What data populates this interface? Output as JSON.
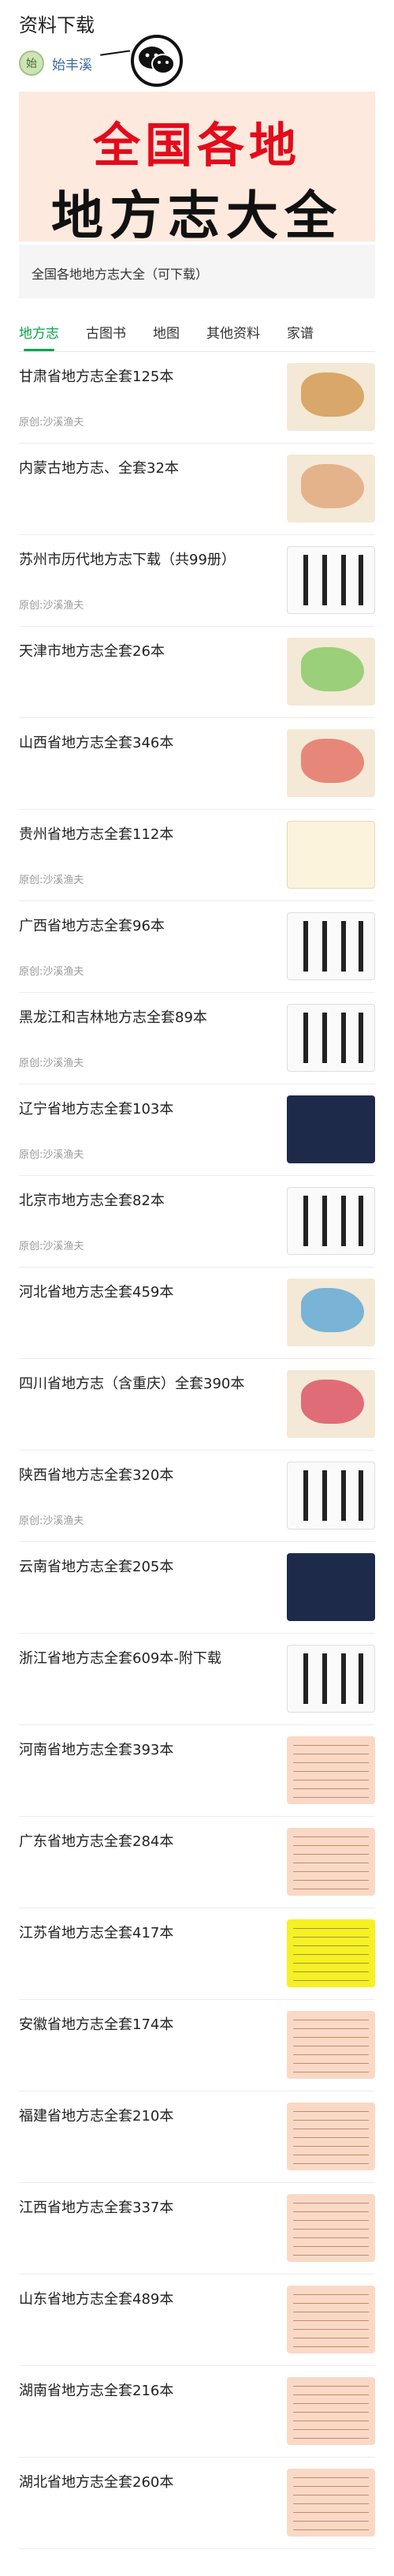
{
  "header": {
    "title": "资料下载",
    "author_name": "始丰溪",
    "avatar_text": "始"
  },
  "banner": {
    "line1": "全国各地",
    "line2": "地方志大全",
    "caption": "全国各地地方志大全（可下载）"
  },
  "tabs": [
    {
      "label": "地方志",
      "active": true
    },
    {
      "label": "古图书",
      "active": false
    },
    {
      "label": "地图",
      "active": false
    },
    {
      "label": "其他资料",
      "active": false
    },
    {
      "label": "家谱",
      "active": false
    }
  ],
  "items": [
    {
      "title": "甘肃省地方志全套125本",
      "source": "原创:沙溪渔夫",
      "thumb": "map",
      "color": "#d9a76a"
    },
    {
      "title": "内蒙古地方志、全套32本",
      "source": "",
      "thumb": "map",
      "color": "#e4b38c"
    },
    {
      "title": "苏州市历代地方志下载（共99册）",
      "source": "原创:沙溪渔夫",
      "thumb": "book",
      "color": "#222222"
    },
    {
      "title": "天津市地方志全套26本",
      "source": "",
      "thumb": "map",
      "color": "#9ccf7a"
    },
    {
      "title": "山西省地方志全套346本",
      "source": "",
      "thumb": "map",
      "color": "#e7877a"
    },
    {
      "title": "贵州省地方志全套112本",
      "source": "原创:沙溪渔夫",
      "thumb": "plain",
      "color": "#e7d9b0"
    },
    {
      "title": "广西省地方志全套96本",
      "source": "原创:沙溪渔夫",
      "thumb": "book",
      "color": "#222222"
    },
    {
      "title": "黑龙江和吉林地方志全套89本",
      "source": "原创:沙溪渔夫",
      "thumb": "book",
      "color": "#222222"
    },
    {
      "title": "辽宁省地方志全套103本",
      "source": "原创:沙溪渔夫",
      "thumb": "dark",
      "color": "#1d2a4a"
    },
    {
      "title": "北京市地方志全套82本",
      "source": "原创:沙溪渔夫",
      "thumb": "book",
      "color": "#222222"
    },
    {
      "title": "河北省地方志全套459本",
      "source": "",
      "thumb": "map",
      "color": "#79b3d6"
    },
    {
      "title": "四川省地方志（含重庆）全套390本",
      "source": "",
      "thumb": "map",
      "color": "#e06c78"
    },
    {
      "title": "陕西省地方志全套320本",
      "source": "原创:沙溪渔夫",
      "thumb": "book",
      "color": "#222222"
    },
    {
      "title": "云南省地方志全套205本",
      "source": "",
      "thumb": "dark",
      "color": "#14243f"
    },
    {
      "title": "浙江省地方志全套609本-附下载",
      "source": "",
      "thumb": "book",
      "color": "#222222"
    },
    {
      "title": "河南省地方志全套393本",
      "source": "",
      "thumb": "table",
      "color": "#f9d9c6"
    },
    {
      "title": "广东省地方志全套284本",
      "source": "",
      "thumb": "table",
      "color": "#f9d9c6"
    },
    {
      "title": "江苏省地方志全套417本",
      "source": "",
      "thumb": "yellow",
      "color": "#f6f024"
    },
    {
      "title": "安徽省地方志全套174本",
      "source": "",
      "thumb": "table",
      "color": "#f9d9c6"
    },
    {
      "title": "福建省地方志全套210本",
      "source": "",
      "thumb": "table",
      "color": "#f9d9c6"
    },
    {
      "title": "江西省地方志全套337本",
      "source": "",
      "thumb": "table",
      "color": "#f9d9c6"
    },
    {
      "title": "山东省地方志全套489本",
      "source": "",
      "thumb": "table",
      "color": "#f9d9c6"
    },
    {
      "title": "湖南省地方志全套216本",
      "source": "",
      "thumb": "table",
      "color": "#f9d9c6"
    },
    {
      "title": "湖北省地方志全套260本",
      "source": "",
      "thumb": "table",
      "color": "#f9d9c6"
    }
  ],
  "colors": {
    "accent": "#07a64a",
    "banner_red": "#e30b1c",
    "banner_bg": "#fde9dd"
  },
  "icons": {
    "wechat": "wechat-icon"
  }
}
